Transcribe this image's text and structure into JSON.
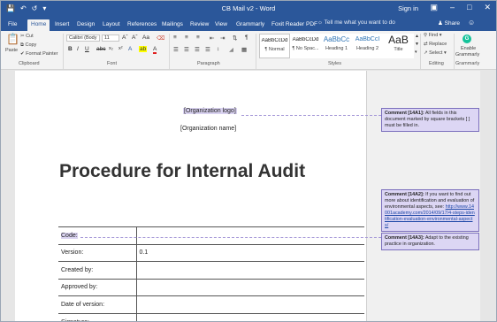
{
  "window": {
    "title": "CB Mail v2 - Word",
    "signin": "Sign in",
    "share": "Share"
  },
  "tabs": [
    "File",
    "Home",
    "Insert",
    "Design",
    "Layout",
    "References",
    "Mailings",
    "Review",
    "View",
    "Grammarly",
    "Foxit Reader PDF"
  ],
  "tell_me": "Tell me what you want to do",
  "ribbon": {
    "clipboard": {
      "paste": "Paste",
      "cut": "Cut",
      "copy": "Copy",
      "format_painter": "Format Painter",
      "label": "Clipboard"
    },
    "font": {
      "name": "Calibri (Body",
      "size": "11",
      "label": "Font"
    },
    "paragraph": {
      "label": "Paragraph"
    },
    "styles": {
      "label": "Styles",
      "items": [
        {
          "preview": "AaBbCcDd",
          "name": "¶ Normal"
        },
        {
          "preview": "AaBbCcDd",
          "name": "¶ No Spac..."
        },
        {
          "preview": "AaBbCc",
          "name": "Heading 1"
        },
        {
          "preview": "AaBbCcI",
          "name": "Heading 2"
        },
        {
          "preview": "AaB",
          "name": "Title"
        }
      ]
    },
    "editing": {
      "find": "Find",
      "replace": "Replace",
      "select": "Select",
      "label": "Editing"
    },
    "grammarly": {
      "enable": "Enable",
      "name": "Grammarly",
      "label": "Grammarly"
    }
  },
  "document": {
    "org_logo": "[Organization logo]",
    "org_name": "[Organization name]",
    "title": "Procedure for Internal Audit",
    "table": [
      {
        "label": "Code:",
        "value": ""
      },
      {
        "label": "Version:",
        "value": "0.1"
      },
      {
        "label": "Created by:",
        "value": ""
      },
      {
        "label": "Approved by:",
        "value": ""
      },
      {
        "label": "Date of version:",
        "value": ""
      },
      {
        "label": "Signature:",
        "value": ""
      }
    ]
  },
  "comments": [
    {
      "id": "Comment [14A1]:",
      "text": " All fields in this document marked by square brackets [ ] must be filled in.",
      "link": ""
    },
    {
      "id": "Comment [14A2]:",
      "text": " If you want to find out more about identification and evaluation of environmental aspects, see: ",
      "link": "http://www.14001academy.com/2014/09/17/4-steps-identification-evaluation-environmental-aspects/"
    },
    {
      "id": "Comment [14A3]:",
      "text": " Adapt to the existing practice in organization.",
      "link": ""
    }
  ]
}
